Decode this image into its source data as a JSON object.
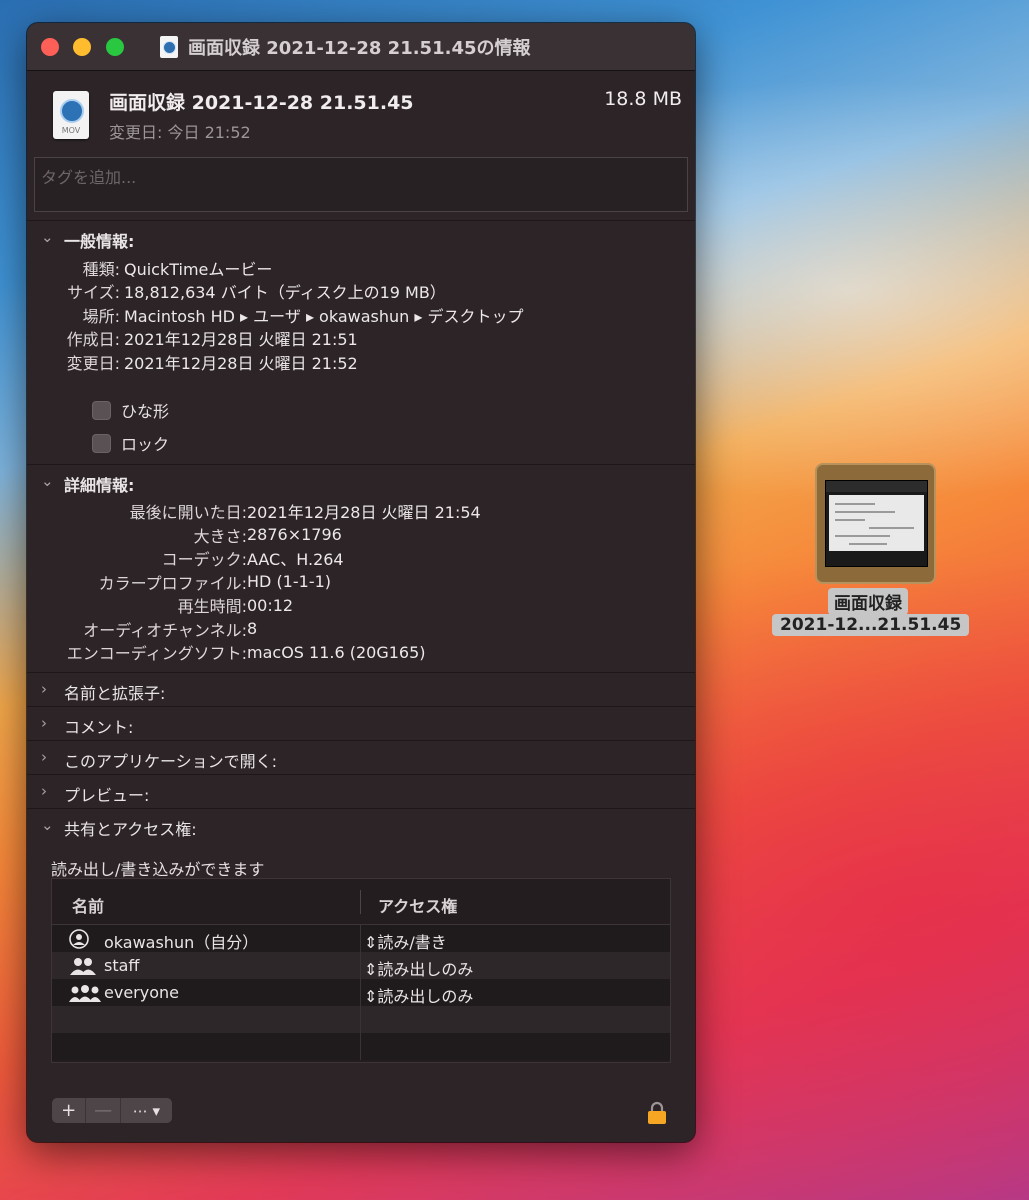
{
  "window": {
    "title": "画面収録 2021-12-28 21.51.45の情報"
  },
  "header": {
    "file_name": "画面収録 2021-12-28 21.51.45",
    "file_size": "18.8 MB",
    "modified": "変更日: 今日 21:52",
    "icon_label": "MOV"
  },
  "tags": {
    "placeholder": "タグを追加..."
  },
  "general": {
    "title": "一般情報:",
    "rows": [
      {
        "k": "種類:",
        "v": "QuickTimeムービー"
      },
      {
        "k": "サイズ:",
        "v": "18,812,634 バイト（ディスク上の19 MB）"
      },
      {
        "k": "場所:",
        "v": "Macintosh HD ▸ ユーザ ▸ okawashun ▸ デスクトップ"
      },
      {
        "k": "作成日:",
        "v": "2021年12月28日 火曜日 21:51"
      },
      {
        "k": "変更日:",
        "v": "2021年12月28日 火曜日 21:52"
      }
    ],
    "stationery": "ひな形",
    "locked": "ロック"
  },
  "details": {
    "title": "詳細情報:",
    "rows": [
      {
        "k": "最後に開いた日:",
        "v": "2021年12月28日 火曜日 21:54"
      },
      {
        "k": "大きさ:",
        "v": "2876×1796"
      },
      {
        "k": "コーデック:",
        "v": "AAC、H.264"
      },
      {
        "k": "カラープロファイル:",
        "v": "HD (1-1-1)"
      },
      {
        "k": "再生時間:",
        "v": "00:12"
      },
      {
        "k": "オーディオチャンネル:",
        "v": "8"
      },
      {
        "k": "エンコーディングソフト:",
        "v": "macOS 11.6 (20G165)"
      }
    ]
  },
  "collapsed_sections": [
    "名前と拡張子:",
    "コメント:",
    "このアプリケーションで開く:",
    "プレビュー:"
  ],
  "sharing": {
    "title": "共有とアクセス権:",
    "note": "読み出し/書き込みができます",
    "col_name": "名前",
    "col_access": "アクセス権",
    "rows": [
      {
        "name": "okawashun（自分）",
        "access": "読み/書き",
        "icon": "user-icon"
      },
      {
        "name": "staff",
        "access": "読み出しのみ",
        "icon": "group-icon"
      },
      {
        "name": "everyone",
        "access": "読み出しのみ",
        "icon": "everyone-icon"
      }
    ],
    "add": "+",
    "remove": "—",
    "more": "⋯ ▾"
  },
  "desktop": {
    "label_line1": "画面収録",
    "label_line2": "2021-12...21.51.45"
  },
  "colors": {
    "window_bg": "#2c2427",
    "close": "#fe5f57",
    "minimize": "#febc2e",
    "zoom": "#29c840",
    "lock": "#f5a623"
  }
}
